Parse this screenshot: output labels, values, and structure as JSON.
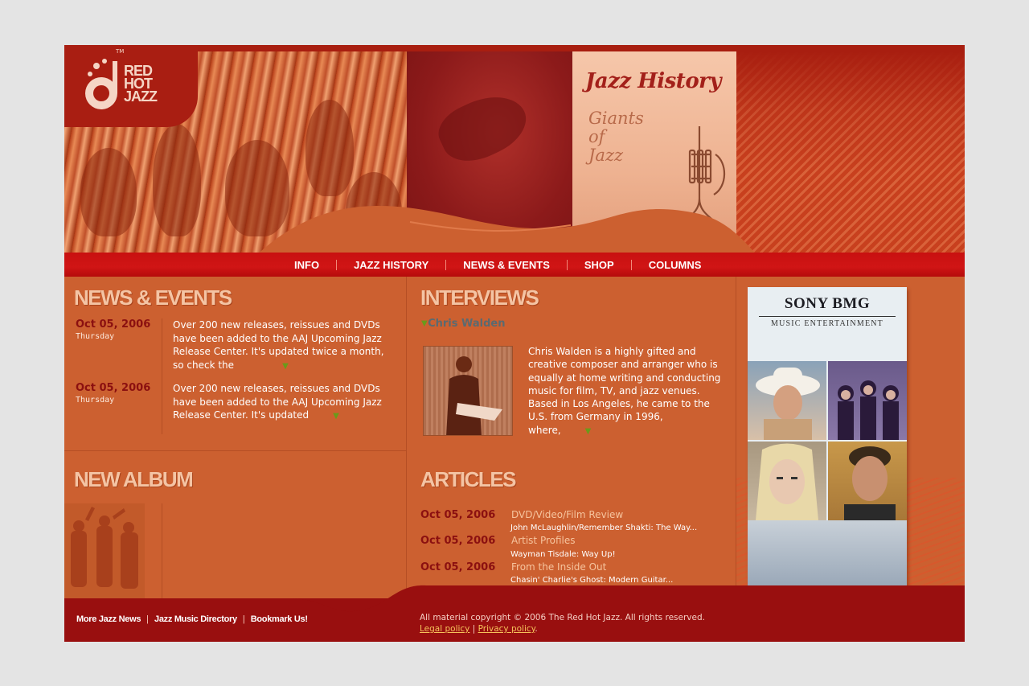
{
  "brand": {
    "logo_text": "RED\nHOT\nJAZZ",
    "trademark": "TM"
  },
  "header": {
    "promo_title": "Jazz History",
    "promo_subtitle": "Giants\nof\nJazz"
  },
  "nav": {
    "items": [
      "INFO",
      "JAZZ HISTORY",
      "NEWS & EVENTS",
      "SHOP",
      "COLUMNS"
    ]
  },
  "news": {
    "title": "NEWS & EVENTS",
    "items": [
      {
        "date": "Oct 05, 2006",
        "day": "Thursday",
        "text": "Over 200 new releases, reissues and DVDs have been added to the AAJ Upcoming Jazz Release Center. It's updated twice a month, so check the"
      },
      {
        "date": "Oct 05, 2006",
        "day": "Thursday",
        "text": "Over 200 new releases, reissues and DVDs have been added to the AAJ Upcoming Jazz Release Center. It's updated"
      }
    ]
  },
  "album": {
    "title": "NEW ALBUM"
  },
  "interviews": {
    "title": "INTERVIEWS",
    "name": "Chris Walden",
    "text": "Chris Walden is a highly gifted and creative composer and arranger who is equally at home writing and conducting music for film, TV, and jazz venues. Based in Los Angeles, he came to the U.S. from Germany in 1996, where,"
  },
  "articles": {
    "title": "ARTICLES",
    "items": [
      {
        "date": "Oct 05, 2006",
        "category": "DVD/Video/Film Review",
        "headline": "John McLaughlin/Remember Shakti: The Way..."
      },
      {
        "date": "Oct 05, 2006",
        "category": "Artist Profiles",
        "headline": "Wayman Tisdale: Way Up!"
      },
      {
        "date": "Oct 05, 2006",
        "category": "From the Inside Out",
        "headline": "Chasin' Charlie's Ghost: Modern Guitar..."
      }
    ]
  },
  "ad": {
    "logo": "SONY BMG",
    "tagline": "MUSIC ENTERTAINMENT"
  },
  "footer": {
    "links": [
      "More Jazz News",
      "Jazz Music Directory",
      "Bookmark Us!"
    ],
    "copyright": "All material copyright © 2006 The Red Hot Jazz. All rights reserved.",
    "legal": "Legal policy",
    "privacy": "Privacy policy"
  },
  "colors": {
    "brand_red": "#a91e12",
    "nav_red": "#c81010",
    "content_orange": "#cc6030",
    "date_red": "#8b1010",
    "footer_red": "#990f0f",
    "more_arrow_green": "#6a9a1a"
  }
}
